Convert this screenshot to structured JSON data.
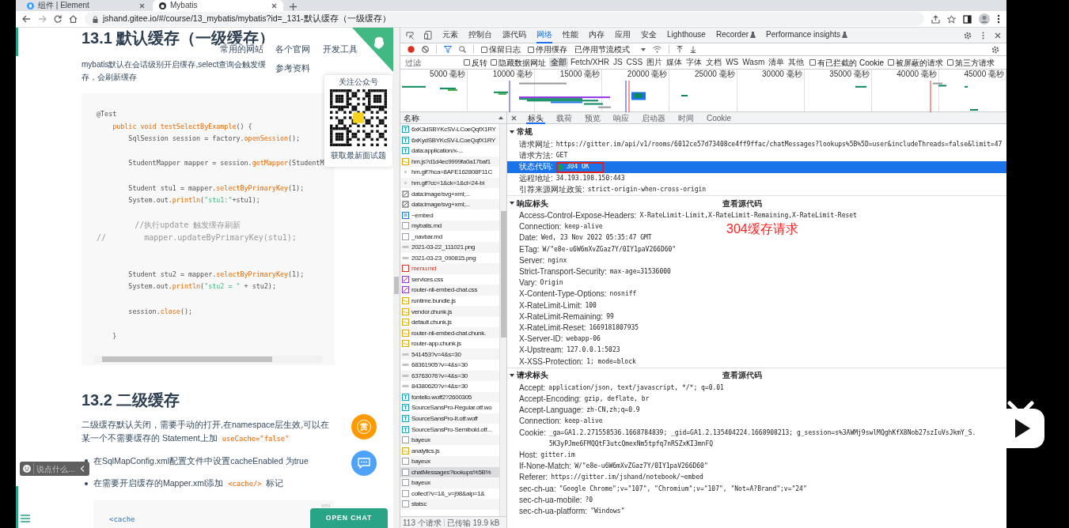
{
  "browser_tabs": [
    {
      "title": "组件 | Element",
      "selected": false
    },
    {
      "title": "Mybatis",
      "selected": true
    }
  ],
  "address_bar": {
    "url": "jshand.gitee.io/#/course/13_mybatis/mybatis?id=_131-默认缓存（一级缓存）"
  },
  "page": {
    "heading_1": "13.1 默认缓存（一级缓存）",
    "nav_links": [
      "常用的网站",
      "各个官网",
      "开发工具",
      "参考资料"
    ],
    "intro": "mybatis默认在会话级别开启缓存,select查询会触发缓存，会刷新缓存",
    "code_block_1": [
      {
        "kind": "code",
        "segments": [
          {
            "kind": "plain",
            "text": "@Test"
          }
        ]
      },
      {
        "kind": "code",
        "segments": [
          {
            "kind": "fn",
            "text": "    public void testSelectByExample"
          },
          {
            "kind": "plain",
            "text": "() {"
          }
        ]
      },
      {
        "kind": "code",
        "segments": [
          {
            "kind": "plain",
            "text": "        SqlSession session = factory."
          },
          {
            "kind": "fn",
            "text": "openSession"
          },
          {
            "kind": "plain",
            "text": "();"
          }
        ]
      },
      {
        "kind": "blank"
      },
      {
        "kind": "code",
        "segments": [
          {
            "kind": "plain",
            "text": "        StudentMapper mapper = session."
          },
          {
            "kind": "fn",
            "text": "getMapper"
          },
          {
            "kind": "plain",
            "text": "(StudentM"
          }
        ]
      },
      {
        "kind": "blank"
      },
      {
        "kind": "code",
        "segments": [
          {
            "kind": "plain",
            "text": "        Student stu1 = mapper."
          },
          {
            "kind": "fn",
            "text": "selectByPrimaryKey"
          },
          {
            "kind": "plain",
            "text": "(1);"
          }
        ]
      },
      {
        "kind": "code",
        "segments": [
          {
            "kind": "plain",
            "text": "        System.out."
          },
          {
            "kind": "fn",
            "text": "println"
          },
          {
            "kind": "plain",
            "text": "("
          },
          {
            "kind": "str",
            "text": "\"stu1:\""
          },
          {
            "kind": "plain",
            "text": "+stu1);"
          }
        ]
      },
      {
        "kind": "blank"
      },
      {
        "kind": "code",
        "segments": [
          {
            "kind": "comment",
            "text": "        //执行update 触发缓存刷新"
          }
        ]
      },
      {
        "kind": "code",
        "segments": [
          {
            "kind": "comment",
            "text": "//        mapper.updateByPrimaryKey(stu1);"
          }
        ]
      },
      {
        "kind": "blank"
      },
      {
        "kind": "blank"
      },
      {
        "kind": "code",
        "segments": [
          {
            "kind": "plain",
            "text": "        Student stu2 = mapper."
          },
          {
            "kind": "fn",
            "text": "selectByPrimaryKey"
          },
          {
            "kind": "plain",
            "text": "(1);"
          }
        ]
      },
      {
        "kind": "code",
        "segments": [
          {
            "kind": "plain",
            "text": "        System.out."
          },
          {
            "kind": "fn",
            "text": "println"
          },
          {
            "kind": "plain",
            "text": "("
          },
          {
            "kind": "str",
            "text": "\"stu2 = \""
          },
          {
            "kind": "plain",
            "text": " + stu2);"
          }
        ]
      },
      {
        "kind": "blank"
      },
      {
        "kind": "code",
        "segments": [
          {
            "kind": "plain",
            "text": "        session."
          },
          {
            "kind": "fn",
            "text": "close"
          },
          {
            "kind": "plain",
            "text": "();"
          }
        ]
      },
      {
        "kind": "blank"
      },
      {
        "kind": "code",
        "segments": [
          {
            "kind": "plain",
            "text": "    }"
          }
        ]
      }
    ],
    "heading_2": "13.2 二级缓存",
    "paragraph": [
      {
        "kind": "text",
        "text": "二级缓存默认关闭，需要手动的打开,在namespace层生效,可以在某一个不需要缓存的 Statement上加 "
      },
      {
        "kind": "code",
        "text": "useCache=\"false\""
      }
    ],
    "bullets": [
      [
        {
          "kind": "text",
          "text": "在SqlMapConfig.xml配置文件中设置cacheEnabled 为true"
        }
      ],
      [
        {
          "kind": "text",
          "text": "在需要开启缓存的Mapper.xml添加 "
        },
        {
          "kind": "code",
          "text": "<cache/>"
        },
        {
          "kind": "text",
          "text": " 标记"
        }
      ]
    ],
    "code_block_2": {
      "lang": "xml",
      "lines": [
        "<cache"
      ]
    },
    "qr_card": {
      "title": "关注公众号",
      "caption": "获取最新面试题"
    },
    "reward_button": "赏",
    "comment_bar": {
      "placeholder": "说点什么..."
    },
    "open_chat": "OPEN CHAT"
  },
  "devtools": {
    "tabs": [
      {
        "label": "元素",
        "selected": false,
        "experimental": false
      },
      {
        "label": "控制台",
        "selected": false,
        "experimental": false
      },
      {
        "label": "源代码",
        "selected": false,
        "experimental": false
      },
      {
        "label": "网络",
        "selected": true,
        "experimental": false
      },
      {
        "label": "性能",
        "selected": false,
        "experimental": false
      },
      {
        "label": "内存",
        "selected": false,
        "experimental": false
      },
      {
        "label": "应用",
        "selected": false,
        "experimental": false
      },
      {
        "label": "安全",
        "selected": false,
        "experimental": false
      },
      {
        "label": "Lighthouse",
        "selected": false,
        "experimental": false
      },
      {
        "label": "Recorder",
        "selected": false,
        "experimental": true
      },
      {
        "label": "Performance insights",
        "selected": false,
        "experimental": true
      }
    ],
    "toolbar": {
      "recording": true,
      "checkboxes": [
        {
          "label": "保留日志",
          "checked": false
        },
        {
          "label": "停用缓存",
          "checked": false
        }
      ],
      "throttling": "已停用节流模式"
    },
    "filter": {
      "placeholder": "过滤",
      "checkboxes": [
        {
          "label": "反转",
          "checked": false
        },
        {
          "label": "隐藏数据网址",
          "checked": false
        }
      ],
      "types": [
        {
          "label": "全部",
          "selected": true
        },
        {
          "label": "Fetch/XHR",
          "selected": false
        },
        {
          "label": "JS",
          "selected": false
        },
        {
          "label": "CSS",
          "selected": false
        },
        {
          "label": "图片",
          "selected": false
        },
        {
          "label": "媒体",
          "selected": false
        },
        {
          "label": "字体",
          "selected": false
        },
        {
          "label": "文档",
          "selected": false
        },
        {
          "label": "WS",
          "selected": false
        },
        {
          "label": "Wasm",
          "selected": false
        },
        {
          "label": "清单",
          "selected": false
        },
        {
          "label": "其他",
          "selected": false
        }
      ],
      "extra_checkboxes": [
        {
          "label": "有已拦截的 Cookie",
          "checked": false
        },
        {
          "label": "被屏蔽的请求",
          "checked": false
        },
        {
          "label": "第三方请求",
          "checked": false
        }
      ]
    },
    "timeline_ticks": [
      "5000 毫秒",
      "10000 毫秒",
      "15000 毫秒",
      "20000 毫秒",
      "25000 毫秒",
      "30000 毫秒",
      "35000 毫秒",
      "40000 毫秒",
      "45000 毫秒"
    ],
    "list_header": "名称",
    "requests": [
      {
        "name": "6xK3dSBYKcSV-LCoeQqfX1RY",
        "kind": "font",
        "selected": false,
        "failed": false
      },
      {
        "name": "6xKydSBYKcSV-LCoeQqfX1RY",
        "kind": "font",
        "selected": false,
        "failed": false
      },
      {
        "name": "data:application/x-...",
        "kind": "font",
        "selected": false,
        "failed": false
      },
      {
        "name": "hm.js?d1d4ec9999fa0a17baf1",
        "kind": "script",
        "selected": false,
        "failed": false
      },
      {
        "name": "hm.gif?hca=8AFE162808F11C",
        "kind": "pixel",
        "selected": false,
        "failed": false
      },
      {
        "name": "hm.gif?cc=1&ck=1&cl=24-bi",
        "kind": "pixel",
        "selected": false,
        "failed": false
      },
      {
        "name": "data:image/svg+xml;...",
        "kind": "svg",
        "selected": false,
        "failed": false
      },
      {
        "name": "data:image/svg+xml;...",
        "kind": "svg",
        "selected": false,
        "failed": false
      },
      {
        "name": "~embed",
        "kind": "doc",
        "selected": false,
        "failed": false
      },
      {
        "name": "mybatis.md",
        "kind": "file",
        "selected": false,
        "failed": false
      },
      {
        "name": "_navbar.md",
        "kind": "file",
        "selected": false,
        "failed": false
      },
      {
        "name": "2021-03-22_111021.png",
        "kind": "image",
        "selected": false,
        "failed": false
      },
      {
        "name": "2021-03-23_090815.png",
        "kind": "image",
        "selected": false,
        "failed": false
      },
      {
        "name": "menu.md",
        "kind": "file",
        "selected": false,
        "failed": true
      },
      {
        "name": "services.css",
        "kind": "css",
        "selected": false,
        "failed": false
      },
      {
        "name": "router-nli-embed-chat.css",
        "kind": "css",
        "selected": false,
        "failed": false
      },
      {
        "name": "runtime.bundle.js",
        "kind": "script",
        "selected": false,
        "failed": false
      },
      {
        "name": "vendor.chunk.js",
        "kind": "script",
        "selected": false,
        "failed": false
      },
      {
        "name": "default.chunk.js",
        "kind": "script",
        "selected": false,
        "failed": false
      },
      {
        "name": "router-nli-embed-chat.chunk.",
        "kind": "script",
        "selected": false,
        "failed": false
      },
      {
        "name": "router-app.chunk.js",
        "kind": "script",
        "selected": false,
        "failed": false
      },
      {
        "name": "541453?v=4&s=30",
        "kind": "image",
        "selected": false,
        "failed": false
      },
      {
        "name": "68361905?v=4&s=30",
        "kind": "image",
        "selected": false,
        "failed": false
      },
      {
        "name": "63763076?v=4&s=30",
        "kind": "image",
        "selected": false,
        "failed": false
      },
      {
        "name": "84380620?v=4&s=30",
        "kind": "image",
        "selected": false,
        "failed": false
      },
      {
        "name": "fontello.woff2?2600305",
        "kind": "font",
        "selected": false,
        "failed": false
      },
      {
        "name": "SourceSansPro-Regular.otf.wo",
        "kind": "font",
        "selected": false,
        "failed": false
      },
      {
        "name": "SourceSansPro-It.otf.woff",
        "kind": "font",
        "selected": false,
        "failed": false
      },
      {
        "name": "SourceSansPro-Semibold.otf...",
        "kind": "font",
        "selected": false,
        "failed": false
      },
      {
        "name": "bayeux",
        "kind": "file",
        "selected": false,
        "failed": false
      },
      {
        "name": "analytics.js",
        "kind": "script",
        "selected": false,
        "failed": false
      },
      {
        "name": "bayeux",
        "kind": "file",
        "selected": false,
        "failed": false
      },
      {
        "name": "chatMessages?lookups%5B%",
        "kind": "file",
        "selected": true,
        "failed": false
      },
      {
        "name": "bayeux",
        "kind": "file",
        "selected": false,
        "failed": false
      },
      {
        "name": "collect?v=1&_v=j98&aip=1&",
        "kind": "file",
        "selected": false,
        "failed": false
      },
      {
        "name": "statsc",
        "kind": "file",
        "selected": false,
        "failed": false
      }
    ],
    "summary": [
      "113 个请求",
      "已传输 19.9 kB"
    ],
    "detail_tabs": [
      {
        "label": "标头",
        "selected": true
      },
      {
        "label": "载荷",
        "selected": false
      },
      {
        "label": "预览",
        "selected": false
      },
      {
        "label": "响应",
        "selected": false
      },
      {
        "label": "启动器",
        "selected": false
      },
      {
        "label": "时间",
        "selected": false
      },
      {
        "label": "Cookie",
        "selected": false
      }
    ],
    "sections": [
      {
        "title": "常规",
        "expanded": true,
        "rows": [
          {
            "key": "请求网址:",
            "value": "https://gitter.im/api/v1/rooms/6012ce57d73408ce4ff9ffac/chatMessages?lookups%5B%5D=user&includeThreads=false&limit=47",
            "kind": "plain",
            "selected": false
          },
          {
            "key": "请求方法:",
            "value": "GET",
            "kind": "plain",
            "selected": false
          },
          {
            "key": "状态代码:",
            "value": "304 OK",
            "kind": "status",
            "selected": true
          },
          {
            "key": "远程地址:",
            "value": "34.193.198.150:443",
            "kind": "plain",
            "selected": false
          },
          {
            "key": "引荐来源网址政策:",
            "value": "strict-origin-when-cross-origin",
            "kind": "plain",
            "selected": false
          }
        ]
      },
      {
        "title": "响应标头",
        "expanded": true,
        "view_source": "查看源代码",
        "rows": [
          {
            "key": "Access-Control-Expose-Headers:",
            "value": "X-RateLimit-Limit,X-RateLimit-Remaining,X-RateLimit-Reset"
          },
          {
            "key": "Connection:",
            "value": "keep-alive"
          },
          {
            "key": "Date:",
            "value": "Wed, 23 Nov 2022 05:35:47 GMT"
          },
          {
            "key": "ETag:",
            "value": "W/\"e8e-u6W6mXvZGaz7Y/0IY1paV266D60\""
          },
          {
            "key": "Server:",
            "value": "nginx"
          },
          {
            "key": "Strict-Transport-Security:",
            "value": "max-age=31536000"
          },
          {
            "key": "Vary:",
            "value": "Origin"
          },
          {
            "key": "X-Content-Type-Options:",
            "value": "nosniff"
          },
          {
            "key": "X-RateLimit-Limit:",
            "value": "100"
          },
          {
            "key": "X-RateLimit-Remaining:",
            "value": "99"
          },
          {
            "key": "X-RateLimit-Reset:",
            "value": "1669181807935"
          },
          {
            "key": "X-Server-ID:",
            "value": "webapp-06"
          },
          {
            "key": "X-Upstream:",
            "value": "127.0.0.1:5023"
          },
          {
            "key": "X-XSS-Protection:",
            "value": "1; mode=block"
          }
        ]
      },
      {
        "title": "请求标头",
        "expanded": true,
        "view_source": "查看源代码",
        "rows": [
          {
            "key": "Accept:",
            "value": "application/json, text/javascript, */*; q=0.01"
          },
          {
            "key": "Accept-Encoding:",
            "value": "gzip, deflate, br"
          },
          {
            "key": "Accept-Language:",
            "value": "zh-CN,zh;q=0.9"
          },
          {
            "key": "Connection:",
            "value": "keep-alive"
          },
          {
            "key": "Cookie:",
            "value": "_ga=GA1.2.271558536.1668784839; _gid=GA1.2.135404224.1668908213; g_session=s%3AWMj9swlMQghKfX8Nob27szIuVsJkmY_S.5K3yPJme6FMQQtF3utcQmexNm5tpfq7nRSZxKI3mnFQ"
          },
          {
            "key": "Host:",
            "value": "gitter.im"
          },
          {
            "key": "If-None-Match:",
            "value": "W/\"e8e-u6W6mXvZGaz7Y/0IY1paV266D60\""
          },
          {
            "key": "Referer:",
            "value": "https://gitter.im/jshand/notebook/~embed"
          },
          {
            "key": "sec-ch-ua:",
            "value": "\"Google Chrome\";v=\"107\", \"Chromium\";v=\"107\", \"Not=A?Brand\";v=\"24\""
          },
          {
            "key": "sec-ch-ua-mobile:",
            "value": "?0"
          },
          {
            "key": "sec-ch-ua-platform:",
            "value": "\"Windows\""
          }
        ]
      }
    ]
  },
  "annotation": {
    "text": "304缓存请求"
  }
}
